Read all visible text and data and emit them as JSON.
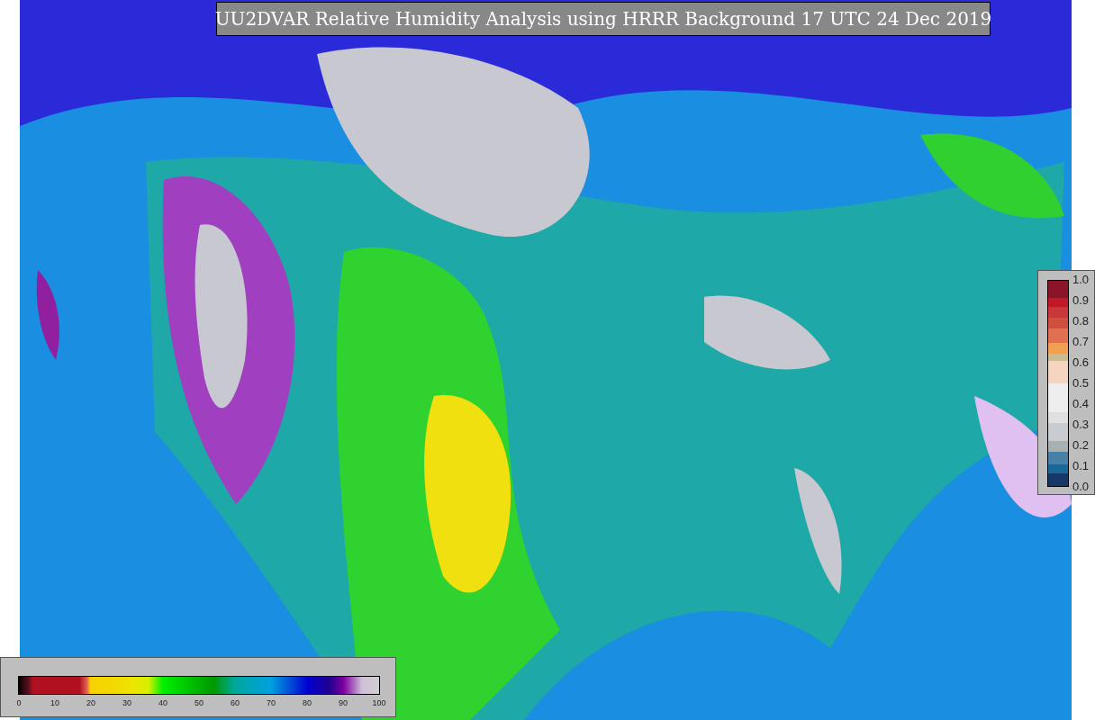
{
  "title": "UU2DVAR Relative Humidity Analysis using HRRR Background 17 UTC 24 Dec 2019",
  "observation_colorbar": {
    "ticks": [
      "1.0",
      "0.9",
      "0.8",
      "0.7",
      "0.6",
      "0.5",
      "0.4",
      "0.3",
      "0.2",
      "0.1",
      "0.0"
    ]
  },
  "humidity_colorbar": {
    "ticks": [
      "0",
      "10",
      "20",
      "30",
      "40",
      "50",
      "60",
      "70",
      "80",
      "90",
      "100"
    ]
  }
}
